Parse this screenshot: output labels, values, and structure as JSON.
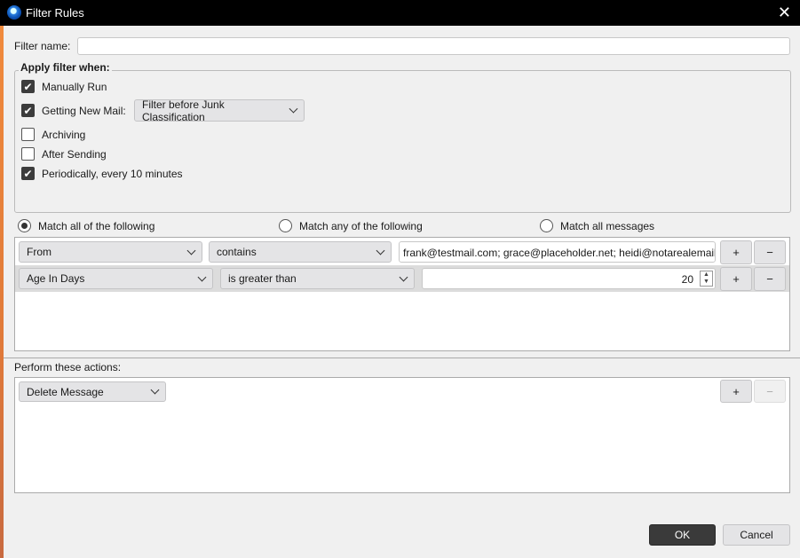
{
  "window": {
    "title": "Filter Rules",
    "close_icon": "close-icon"
  },
  "filter_name": {
    "label": "Filter name:",
    "value": ""
  },
  "apply": {
    "legend": "Apply filter when:",
    "items": [
      {
        "label": "Manually Run",
        "checked": true
      },
      {
        "label": "Getting New Mail:",
        "checked": true
      },
      {
        "label": "Archiving",
        "checked": false
      },
      {
        "label": "After Sending",
        "checked": false
      },
      {
        "label": "Periodically, every 10 minutes",
        "checked": true
      }
    ],
    "junk_select": "Filter before Junk Classification"
  },
  "match": {
    "options": [
      "Match all of the following",
      "Match any of the following",
      "Match all messages"
    ],
    "selected": 0
  },
  "rules": [
    {
      "field": "From",
      "op": "contains",
      "value": "frank@testmail.com; grace@placeholder.net; heidi@notarealemail"
    },
    {
      "field": "Age In Days",
      "op": "is greater than",
      "value": "20"
    }
  ],
  "add_label": "+",
  "remove_label": "−",
  "actions": {
    "label": "Perform these actions:",
    "items": [
      {
        "action": "Delete Message"
      }
    ]
  },
  "footer": {
    "ok": "OK",
    "cancel": "Cancel"
  }
}
